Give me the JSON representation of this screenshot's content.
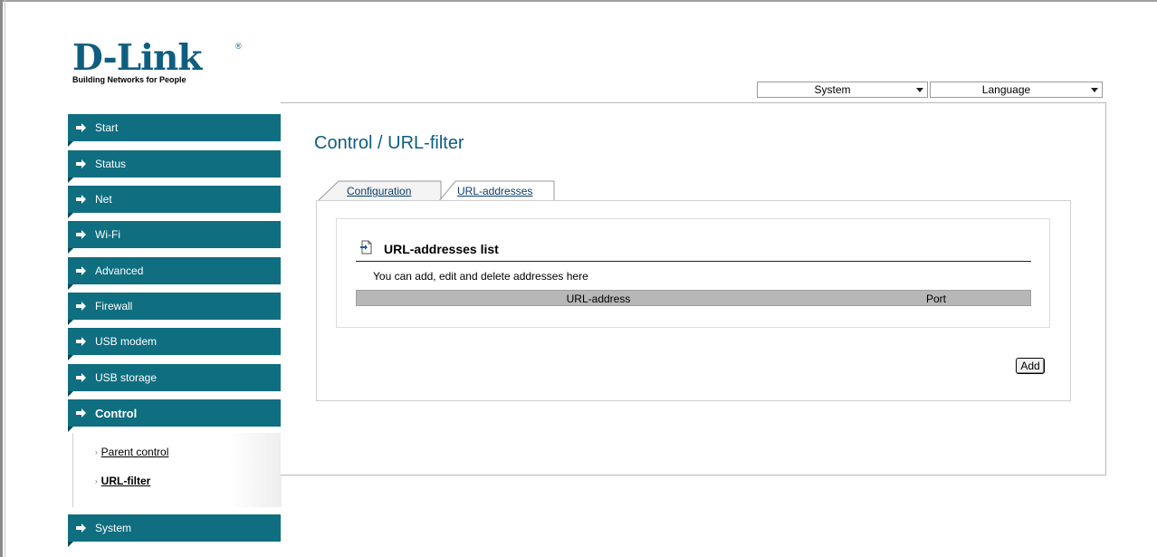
{
  "logo": {
    "brand": "D-Link",
    "registered": "®",
    "tagline": "Building Networks for People"
  },
  "top_selects": {
    "system": "System",
    "language": "Language"
  },
  "sidebar": {
    "items": [
      {
        "label": "Start"
      },
      {
        "label": "Status"
      },
      {
        "label": "Net"
      },
      {
        "label": "Wi-Fi"
      },
      {
        "label": "Advanced"
      },
      {
        "label": "Firewall"
      },
      {
        "label": "USB modem"
      },
      {
        "label": "USB storage"
      },
      {
        "label": "Control"
      },
      {
        "label": "System"
      }
    ],
    "control_submenu": [
      {
        "label": "Parent control"
      },
      {
        "label": "URL-filter"
      }
    ]
  },
  "main": {
    "title": "Control /  URL-filter",
    "tabs": [
      {
        "label": "Configuration"
      },
      {
        "label": "URL-addresses"
      }
    ],
    "section_title": "URL-addresses list",
    "section_desc": "You can add, edit and delete addresses here",
    "table_headers": [
      "URL-address",
      "Port"
    ],
    "add_button": "Add"
  },
  "colors": {
    "nav_bg": "#0f6e80",
    "brand": "#0f5e80",
    "table_header_bg": "#b7b7b7"
  }
}
